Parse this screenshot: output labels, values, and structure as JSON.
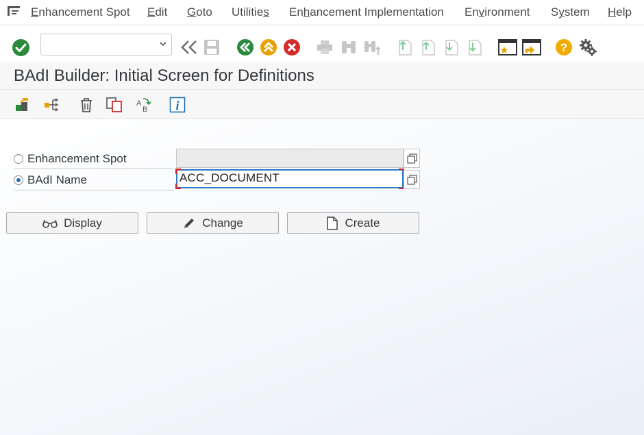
{
  "menu": {
    "items": [
      {
        "label": "Enhancement Spot",
        "underline": "E"
      },
      {
        "label": "Edit",
        "underline": "E"
      },
      {
        "label": "Goto",
        "underline": "G"
      },
      {
        "label": "Utilities",
        "underline": "s"
      },
      {
        "label": "Enhancement Implementation",
        "underline": "h"
      },
      {
        "label": "Environment",
        "underline": "v"
      },
      {
        "label": "System",
        "underline": "y"
      },
      {
        "label": "Help",
        "underline": "H"
      }
    ]
  },
  "toolbar": {
    "command_field_value": "",
    "icons": [
      "enter-icon",
      "save-icon",
      "back-icon",
      "exit-icon",
      "cancel-icon",
      "print-icon",
      "find-icon",
      "find-next-icon",
      "first-page-icon",
      "previous-page-icon",
      "next-page-icon",
      "last-page-icon",
      "new-session-icon",
      "shortcut-icon",
      "help-icon",
      "settings-icon"
    ]
  },
  "title": "BAdI Builder: Initial Screen for Definitions",
  "app_toolbar": {
    "icons": [
      "other-object-icon",
      "where-used-icon",
      "delete-icon",
      "copy-icon",
      "rename-icon",
      "info-icon"
    ]
  },
  "form": {
    "enhancement_spot_label": "Enhancement Spot",
    "enhancement_spot_value": "",
    "badi_name_label": "BAdI Name",
    "badi_name_value": "ACC_DOCUMENT",
    "selected_option": "BAdI Name"
  },
  "buttons": {
    "display_label": "Display",
    "change_label": "Change",
    "create_label": "Create"
  },
  "colors": {
    "accent_blue": "#2c78c9",
    "check_green": "#2b8a3e",
    "nav_yellow": "#e9a100",
    "cancel_red": "#d62b2b",
    "help_yellow": "#f0ab00"
  }
}
